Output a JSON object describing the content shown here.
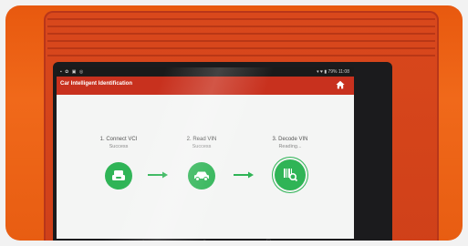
{
  "status_bar": {
    "left_icons": [
      "app-icon",
      "photo-icon",
      "camera-icon",
      "settings-icon"
    ],
    "right_text": "▾ ♥ ▮ 79% 11:08"
  },
  "app": {
    "title": "Car Intelligent Identification",
    "accent_color": "#c8311e",
    "success_color": "#2fb456"
  },
  "steps": [
    {
      "label": "1. Connect VCI",
      "status": "Success",
      "icon": "vci-icon"
    },
    {
      "label": "2. Read VIN",
      "status": "Success",
      "icon": "car-icon"
    },
    {
      "label": "3. Decode VIN",
      "status": "Reading...",
      "icon": "decode-icon"
    }
  ]
}
